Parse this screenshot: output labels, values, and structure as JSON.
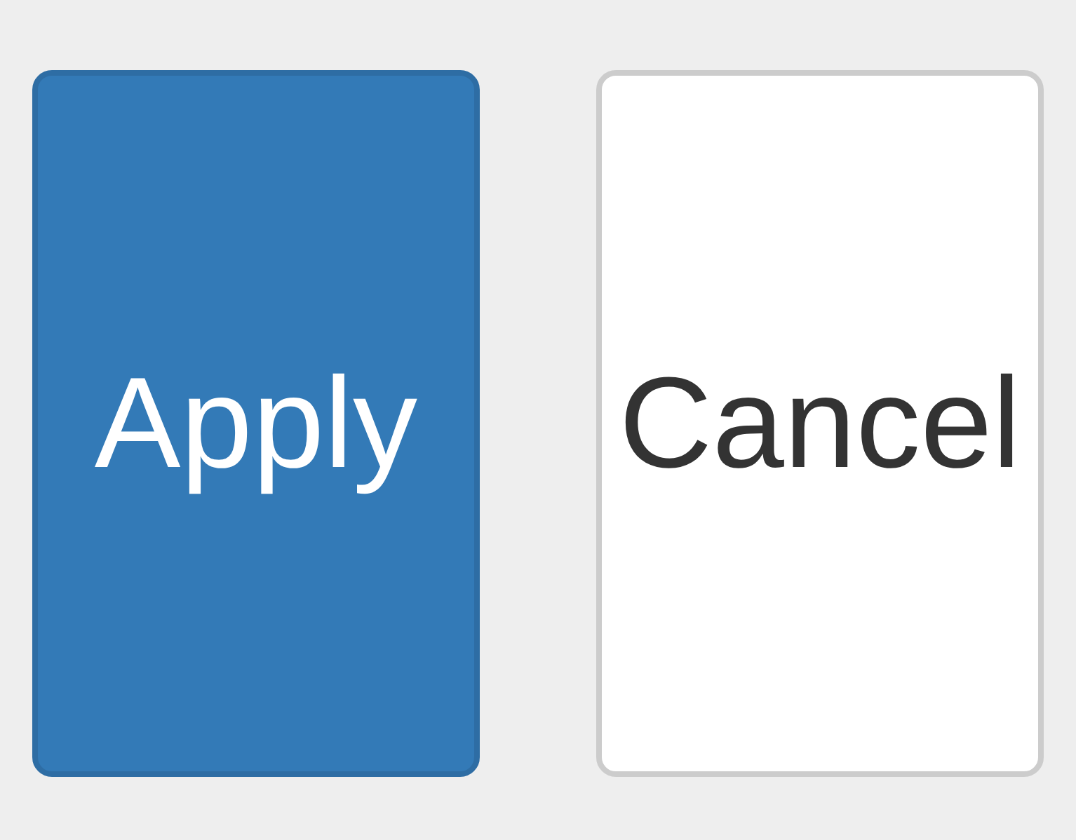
{
  "buttons": [
    {
      "label": "Apply",
      "kind": "primary"
    },
    {
      "label": "Cancel",
      "kind": "default"
    }
  ]
}
